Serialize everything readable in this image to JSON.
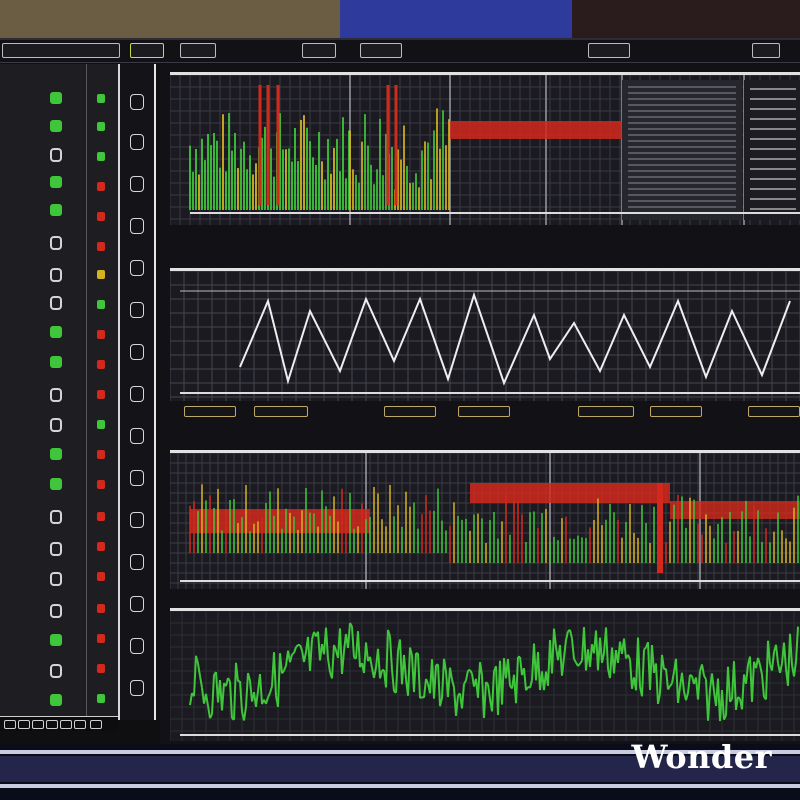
{
  "watermark": {
    "text": "Wonder"
  },
  "colors": {
    "green": "#3fc63a",
    "red": "#d2291c",
    "yellow": "#d6b21f",
    "white": "#e6e6e6",
    "panel_bg": "#1a1a20",
    "frame_blue": "#2f3a8f"
  },
  "icons": {
    "left_glyphs": "status-glyph-icon",
    "side_marks": "channel-marker-icon"
  }
}
